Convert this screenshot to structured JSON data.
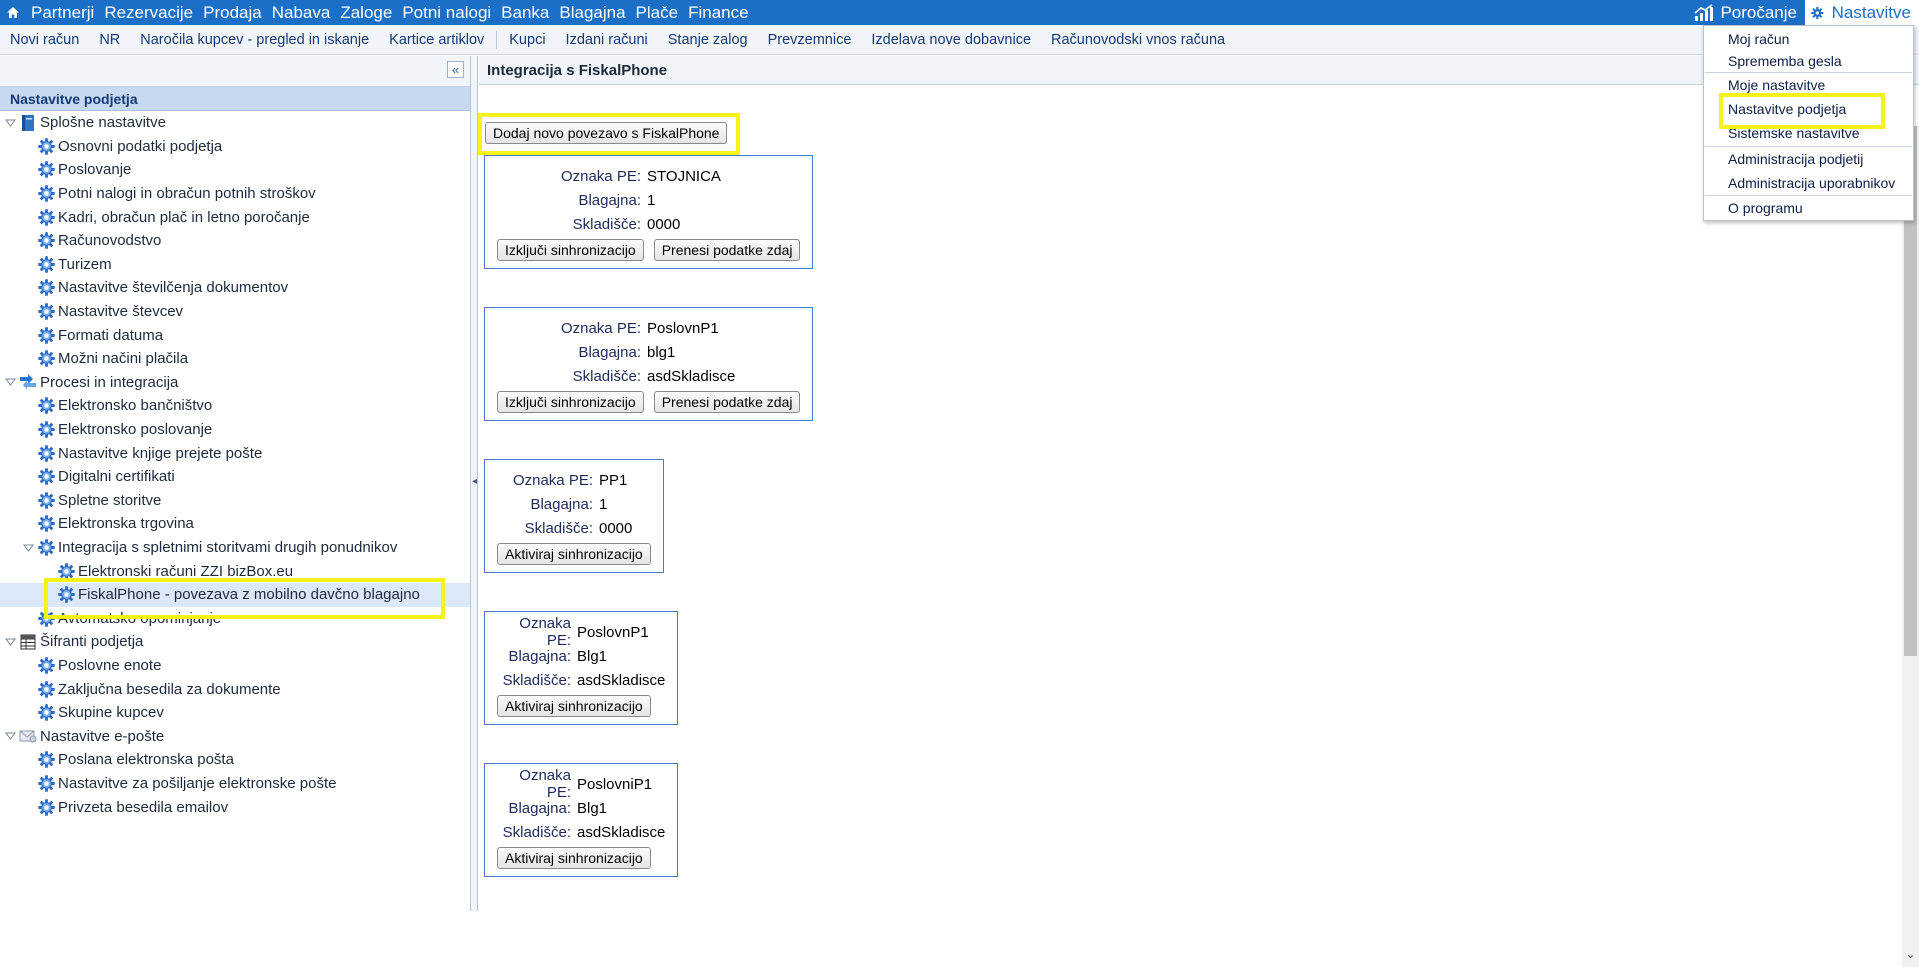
{
  "topbar": {
    "menu": [
      "Partnerji",
      "Rezervacije",
      "Prodaja",
      "Nabava",
      "Zaloge",
      "Potni nalogi",
      "Banka",
      "Blagajna",
      "Plače",
      "Finance"
    ],
    "reports_label": "Poročanje",
    "settings_label": "Nastavitve"
  },
  "toolbar": {
    "group1": [
      "Novi račun",
      "NR",
      "Naročila kupcev - pregled in iskanje",
      "Kartice artiklov"
    ],
    "group2": [
      "Kupci",
      "Izdani računi",
      "Stanje zalog",
      "Prevzemnice",
      "Izdelava nove dobavnice",
      "Računovodski vnos računa"
    ]
  },
  "left_panel": {
    "title": "Nastavitve podjetja",
    "tree": [
      {
        "label": "Splošne nastavitve",
        "level": 0,
        "icon": "book-icon",
        "expand": "open"
      },
      {
        "label": "Osnovni podatki podjetja",
        "level": 1,
        "icon": "gear-icon"
      },
      {
        "label": "Poslovanje",
        "level": 1,
        "icon": "gear-icon"
      },
      {
        "label": "Potni nalogi in obračun potnih stroškov",
        "level": 1,
        "icon": "gear-icon"
      },
      {
        "label": "Kadri, obračun plač in letno poročanje",
        "level": 1,
        "icon": "gear-icon"
      },
      {
        "label": "Računovodstvo",
        "level": 1,
        "icon": "gear-icon"
      },
      {
        "label": "Turizem",
        "level": 1,
        "icon": "gear-icon"
      },
      {
        "label": "Nastavitve številčenja dokumentov",
        "level": 1,
        "icon": "gear-icon"
      },
      {
        "label": "Nastavitve števcev",
        "level": 1,
        "icon": "gear-icon"
      },
      {
        "label": "Formati datuma",
        "level": 1,
        "icon": "gear-icon"
      },
      {
        "label": "Možni načini plačila",
        "level": 1,
        "icon": "gear-icon"
      },
      {
        "label": "Procesi in integracija",
        "level": 0,
        "icon": "process-icon",
        "expand": "open"
      },
      {
        "label": "Elektronsko bančništvo",
        "level": 1,
        "icon": "gear-icon"
      },
      {
        "label": "Elektronsko poslovanje",
        "level": 1,
        "icon": "gear-icon"
      },
      {
        "label": "Nastavitve knjige prejete pošte",
        "level": 1,
        "icon": "gear-icon"
      },
      {
        "label": "Digitalni certifikati",
        "level": 1,
        "icon": "gear-icon"
      },
      {
        "label": "Spletne storitve",
        "level": 1,
        "icon": "gear-icon"
      },
      {
        "label": "Elektronska trgovina",
        "level": 1,
        "icon": "gear-icon"
      },
      {
        "label": "Integracija s spletnimi storitvami drugih ponudnikov",
        "level": 1,
        "icon": "gear-icon",
        "expand": "open"
      },
      {
        "label": "Elektronski računi ZZI bizBox.eu",
        "level": 2,
        "icon": "gear-icon"
      },
      {
        "label": "FiskalPhone - povezava z mobilno davčno blagajno",
        "level": 2,
        "icon": "gear-icon",
        "selected": true
      },
      {
        "label": "Avtomatsko opominjanje",
        "level": 1,
        "icon": "gear-icon"
      },
      {
        "label": "Šifranti podjetja",
        "level": 0,
        "icon": "table-icon",
        "expand": "open"
      },
      {
        "label": "Poslovne enote",
        "level": 1,
        "icon": "gear-icon"
      },
      {
        "label": "Zaključna besedila za dokumente",
        "level": 1,
        "icon": "gear-icon"
      },
      {
        "label": "Skupine kupcev",
        "level": 1,
        "icon": "gear-icon"
      },
      {
        "label": "Nastavitve e-pošte",
        "level": 0,
        "icon": "mail-icon",
        "expand": "open"
      },
      {
        "label": "Poslana elektronska pošta",
        "level": 1,
        "icon": "gear-icon"
      },
      {
        "label": "Nastavitve za pošiljanje elektronske pošte",
        "level": 1,
        "icon": "gear-icon"
      },
      {
        "label": "Privzeta besedila emailov",
        "level": 1,
        "icon": "gear-icon"
      }
    ]
  },
  "content": {
    "title": "Integracija s FiskalPhone",
    "add_button": "Dodaj novo povezavo s FiskalPhone",
    "labels": {
      "pe": "Oznaka PE:",
      "register": "Blagajna:",
      "warehouse": "Skladišče:"
    },
    "cards": [
      {
        "pe": "STOJNICA",
        "register": "1",
        "warehouse": "0000",
        "buttons": [
          "Izključi sinhronizacijo",
          "Prenesi podatke zdaj"
        ]
      },
      {
        "pe": "PoslovnP1",
        "register": "blg1",
        "warehouse": "asdSkladisce",
        "buttons": [
          "Izključi sinhronizacijo",
          "Prenesi podatke zdaj"
        ]
      },
      {
        "pe": "PP1",
        "register": "1",
        "warehouse": "0000",
        "buttons": [
          "Aktiviraj sinhronizacijo"
        ]
      },
      {
        "pe": "PoslovnP1",
        "register": "Blg1",
        "warehouse": "asdSkladisce",
        "buttons": [
          "Aktiviraj sinhronizacijo"
        ]
      },
      {
        "pe": "PoslovniP1",
        "register": "Blg1",
        "warehouse": "asdSkladisce",
        "buttons": [
          "Aktiviraj sinhronizacijo"
        ]
      }
    ]
  },
  "dropdown": {
    "items": [
      "Moj račun",
      "Sprememba gesla",
      "Moje nastavitve",
      "Nastavitve podjetja",
      "Sistemske nastavitve",
      "Administracija podjetij",
      "Administracija uporabnikov",
      "O programu"
    ]
  },
  "colors": {
    "brand": "#1b6fc6",
    "highlight": "#f7f21a",
    "card_border": "#4a79c8"
  }
}
